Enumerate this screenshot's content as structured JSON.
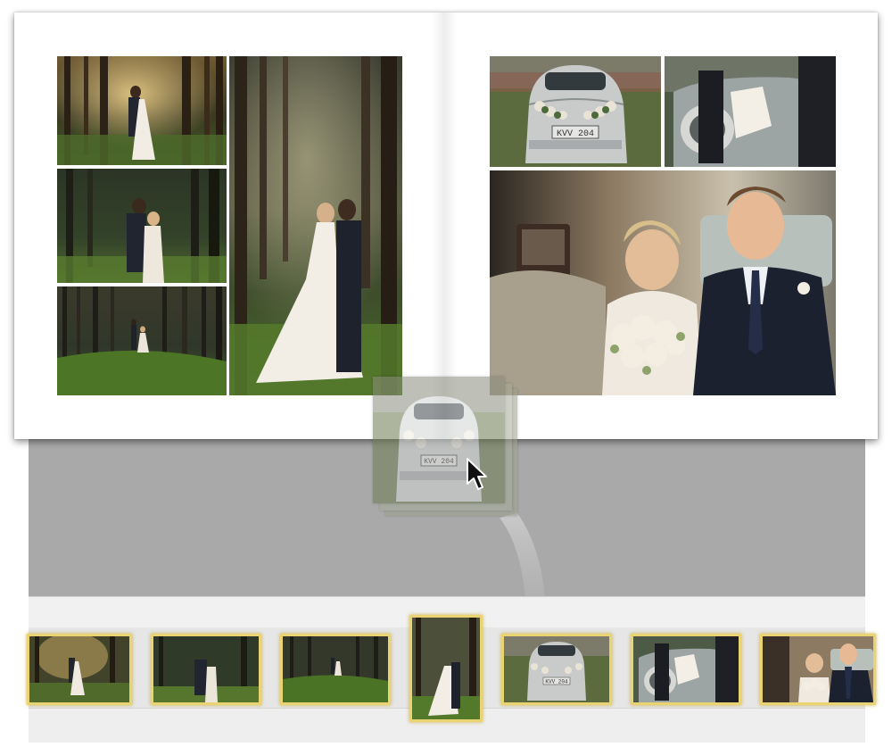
{
  "app": {
    "name": ""
  },
  "album": {
    "left_page": {
      "photos": [
        {
          "id": "forest-couple-embrace",
          "scene": "forest"
        },
        {
          "id": "forest-couple-hug",
          "scene": "forest"
        },
        {
          "id": "forest-couple-distance",
          "scene": "forest"
        },
        {
          "id": "forest-couple-forehead",
          "scene": "forest"
        }
      ]
    },
    "right_page": {
      "photos": [
        {
          "id": "vintage-car-rear",
          "scene": "car",
          "plate_text": "KVV 204"
        },
        {
          "id": "groom-helping-bride",
          "scene": "car"
        },
        {
          "id": "couple-in-car",
          "scene": "car-interior"
        }
      ]
    }
  },
  "drag": {
    "dragged_photo": "vintage-car-rear",
    "stack_count": 3,
    "plate_text": "KVV 204"
  },
  "filmstrip": {
    "thumbnails": [
      {
        "id": "forest-couple-embrace",
        "selected": false
      },
      {
        "id": "forest-couple-hug",
        "selected": false
      },
      {
        "id": "forest-couple-distance",
        "selected": false
      },
      {
        "id": "forest-couple-forehead",
        "selected": true
      },
      {
        "id": "vintage-car-rear",
        "selected": false,
        "plate_text": "KVV 204"
      },
      {
        "id": "groom-helping-bride",
        "selected": false
      },
      {
        "id": "couple-in-car",
        "selected": false
      }
    ]
  },
  "colors": {
    "thumb_border": "#e9d373",
    "workspace": "#a9a9a9",
    "filmstrip": "#e6e6e6"
  },
  "icons": {
    "cursor": "arrow-cursor-icon"
  }
}
